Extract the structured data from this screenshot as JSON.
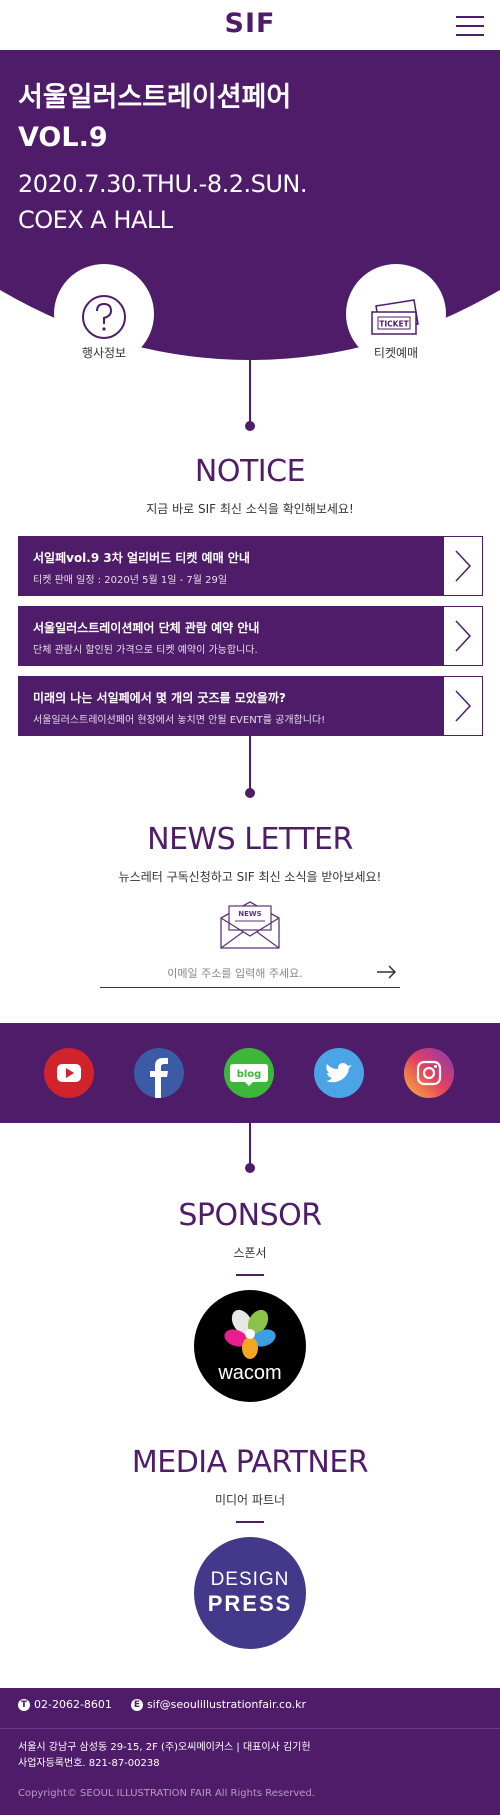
{
  "header": {
    "logo": "SIF"
  },
  "hero": {
    "title_line1": "서울일러스트레이션페어",
    "title_line2": "VOL.9",
    "date": "2020.7.30.THU.-8.2.SUN.",
    "venue": "COEX A HALL",
    "quick_info_label": "행사정보",
    "quick_ticket_label": "티켓예매",
    "ticket_icon_text": "TICKET"
  },
  "notice": {
    "title": "NOTICE",
    "subtitle": "지금 바로 SIF 최신 소식을 확인해보세요!",
    "items": [
      {
        "title": "서일페vol.9 3차 얼리버드 티켓 예매 안내",
        "desc": "티켓 판매 일정 : 2020년 5월 1일 - 7월 29일"
      },
      {
        "title": "서울일러스트레이션페어 단체 관람 예약 안내",
        "desc": "단체 관람시 할인된 가격으로 티켓 예약이 가능합니다."
      },
      {
        "title": "미래의 나는 서일페에서 몇 개의 굿즈를 모았을까?",
        "desc": "서울일러스트레이션페어 현장에서 놓치면 안될 EVENT를 공개합니다!"
      }
    ]
  },
  "newsletter": {
    "title": "NEWS LETTER",
    "subtitle": "뉴스레터 구독신청하고 SIF 최신 소식을 받아보세요!",
    "icon_text": "NEWS",
    "email_placeholder": "이메일 주소를 입력해 주세요."
  },
  "social": {
    "items": [
      {
        "name": "youtube",
        "color": "#d0232c"
      },
      {
        "name": "facebook",
        "color": "#3b5ba6"
      },
      {
        "name": "blog",
        "color": "#3cb838",
        "label": "blog"
      },
      {
        "name": "twitter",
        "color": "#4aa4e6"
      },
      {
        "name": "instagram",
        "color": "#d6387f"
      }
    ]
  },
  "sponsor": {
    "title": "SPONSOR",
    "subtitle": "스폰서",
    "logo_text": "wacom"
  },
  "media": {
    "title": "MEDIA PARTNER",
    "subtitle": "미디어 파트너",
    "logo_line1": "DESIGN",
    "logo_line2": "PRESS"
  },
  "footer": {
    "phone_badge": "T",
    "phone": "02-2062-8601",
    "email_badge": "E",
    "email": "sif@seoulillustrationfair.co.kr",
    "address": "서울시 강남구 삼성동 29-15, 2F (주)오씨메이커스 | 대표이사 김기헌",
    "business_no": "사업자등록번호. 821-87-00238",
    "copyright": "Copyright© SEOUL ILLUSTRATION FAIR All Rights Reserved."
  },
  "colors": {
    "primary": "#4e1c68",
    "white": "#ffffff"
  }
}
